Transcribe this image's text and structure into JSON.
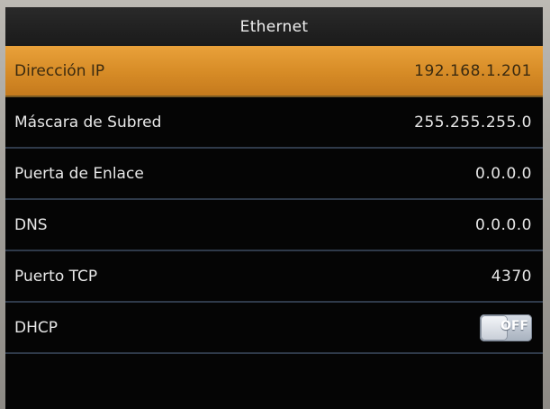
{
  "header": {
    "title": "Ethernet"
  },
  "settings": [
    {
      "label": "Dirección IP",
      "value": "192.168.1.201",
      "selected": true
    },
    {
      "label": "Máscara de Subred",
      "value": "255.255.255.0",
      "selected": false
    },
    {
      "label": "Puerta de Enlace",
      "value": "0.0.0.0",
      "selected": false
    },
    {
      "label": "DNS",
      "value": "0.0.0.0",
      "selected": false
    },
    {
      "label": "Puerto TCP",
      "value": "4370",
      "selected": false
    },
    {
      "label": "DHCP",
      "toggle": "OFF",
      "selected": false
    }
  ],
  "colors": {
    "selected_row": "#d68b26",
    "row_divider": "#2f3a4a",
    "screen_background": "#050505"
  }
}
